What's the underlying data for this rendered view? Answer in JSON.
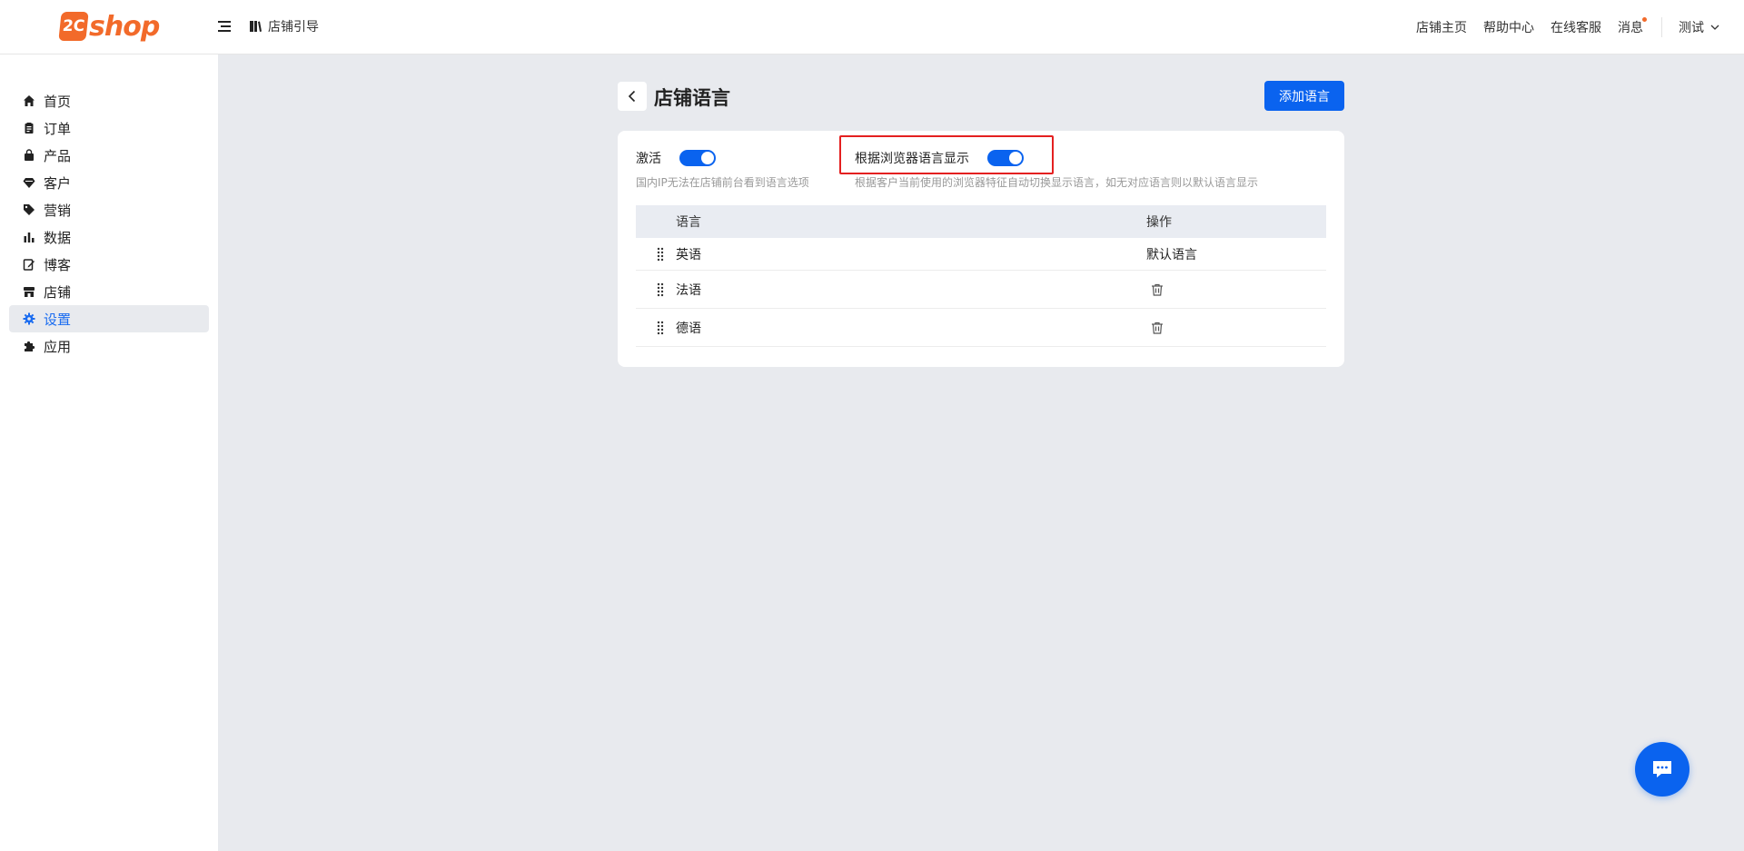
{
  "header": {
    "logo_mark": "2C",
    "logo_text": "shop",
    "guide_label": "店铺引导",
    "links": [
      "店铺主页",
      "帮助中心",
      "在线客服",
      "消息"
    ],
    "user_name": "测试"
  },
  "sidebar": {
    "items": [
      {
        "label": "首页",
        "icon": "home-icon"
      },
      {
        "label": "订单",
        "icon": "clipboard-icon"
      },
      {
        "label": "产品",
        "icon": "bag-icon"
      },
      {
        "label": "客户",
        "icon": "diamond-icon"
      },
      {
        "label": "营销",
        "icon": "tag-icon"
      },
      {
        "label": "数据",
        "icon": "bar-chart-icon"
      },
      {
        "label": "博客",
        "icon": "edit-icon"
      },
      {
        "label": "店铺",
        "icon": "store-icon"
      },
      {
        "label": "设置",
        "icon": "gear-icon",
        "active": true
      },
      {
        "label": "应用",
        "icon": "puzzle-icon"
      }
    ]
  },
  "page": {
    "title": "店铺语言",
    "add_button": "添加语言"
  },
  "settings": {
    "activate": {
      "label": "激活",
      "enabled": true,
      "hint": "国内IP无法在店铺前台看到语言选项"
    },
    "browser_lang": {
      "label": "根据浏览器语言显示",
      "enabled": true,
      "hint": "根据客户当前使用的浏览器特征自动切换显示语言，如无对应语言则以默认语言显示"
    }
  },
  "table": {
    "headers": [
      "语言",
      "操作"
    ],
    "rows": [
      {
        "name": "英语",
        "action": "默认语言"
      },
      {
        "name": "法语",
        "action": "delete"
      },
      {
        "name": "德语",
        "action": "delete"
      }
    ]
  },
  "colors": {
    "primary": "#0a63ef",
    "brand": "#f26a2a",
    "highlight": "#e42020"
  }
}
